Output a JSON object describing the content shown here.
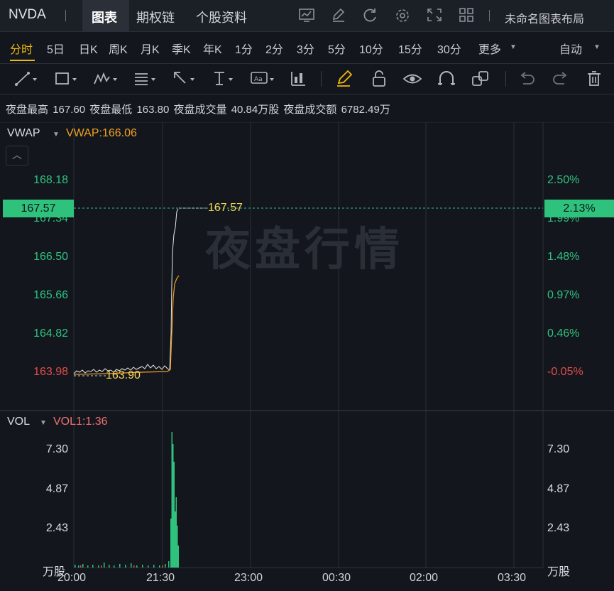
{
  "header": {
    "symbol": "NVDA",
    "tabs": [
      "图表",
      "期权链",
      "个股资料"
    ],
    "layout_name": "未命名图表布局"
  },
  "periods": {
    "items": [
      "分时",
      "5日",
      "日K",
      "周K",
      "月K",
      "季K",
      "年K",
      "1分",
      "2分",
      "3分",
      "5分",
      "10分",
      "15分",
      "30分",
      "更多"
    ],
    "active": "分时",
    "adjust": "自动"
  },
  "stats": {
    "high_label": "夜盘最高",
    "high": "167.60",
    "low_label": "夜盘最低",
    "low": "163.80",
    "vol_label": "夜盘成交量",
    "vol": "40.84万股",
    "amt_label": "夜盘成交额",
    "amt": "6782.49万"
  },
  "price_panel": {
    "indicator_name": "VWAP",
    "indicator_value": "VWAP:166.06",
    "watermark": "夜盘行情",
    "left_ticks": [
      "168.18",
      "167.34",
      "166.50",
      "165.66",
      "164.82",
      "163.98"
    ],
    "right_ticks": [
      "2.50%",
      "1.99%",
      "1.48%",
      "0.97%",
      "0.46%",
      "-0.05%"
    ],
    "current_price": "167.57",
    "current_pct": "2.13%",
    "high_mark": "167.57",
    "low_mark": "163.90"
  },
  "volume_panel": {
    "indicator_name": "VOL",
    "indicator_value": "VOL1:1.36",
    "left_ticks": [
      "7.30",
      "4.87",
      "2.43"
    ],
    "right_ticks": [
      "7.30",
      "4.87",
      "2.43"
    ],
    "unit": "万股"
  },
  "x_axis": [
    "20:00",
    "21:30",
    "23:00",
    "00:30",
    "02:00",
    "03:30"
  ],
  "colors": {
    "up": "#2fc27d",
    "down": "#e34c4c",
    "price_line": "#ffffff",
    "vwap_line": "#f0a020",
    "accent": "#f0b90b"
  },
  "icons": [
    "indicator-icon",
    "edit-icon",
    "refresh-icon",
    "settings-icon",
    "fullscreen-icon",
    "grid-layout-icon"
  ]
}
